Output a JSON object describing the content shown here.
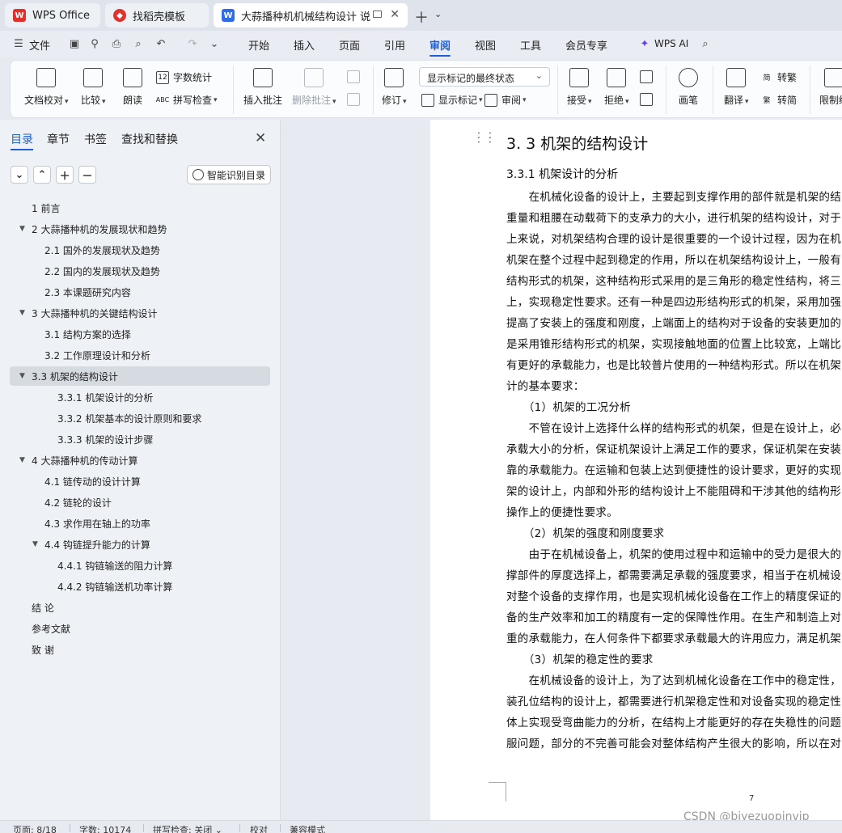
{
  "tabs": [
    {
      "label": "WPS Office",
      "icon": "wps-logo-icon",
      "color": "#e0312d"
    },
    {
      "label": "找稻壳模板",
      "icon": "docer-icon",
      "color": "#e0312d"
    },
    {
      "label": "大蒜播种机机械结构设计 说明",
      "icon": "writer-doc-icon",
      "color": "#2f6be6"
    }
  ],
  "menu": {
    "file": "文件",
    "items": [
      "开始",
      "插入",
      "页面",
      "引用",
      "审阅",
      "视图",
      "工具",
      "会员专享"
    ],
    "active": "审阅",
    "wps_ai": "WPS AI"
  },
  "ribbon": {
    "doc_check": "文档校对",
    "compare": "比较",
    "read_aloud": "朗读",
    "word_count": "字数统计",
    "spell_check": "拼写检查",
    "insert_comment": "插入批注",
    "delete_comment": "删除批注",
    "revise": "修订",
    "markup_state": "显示标记的最终状态",
    "show_markup": "显示标记",
    "review": "审阅",
    "accept": "接受",
    "reject": "拒绝",
    "ink": "画笔",
    "translate": "翻译",
    "to_traditional": "转繁",
    "to_simplified": "转简",
    "restrict": "限制编"
  },
  "nav": {
    "tabs": [
      "目录",
      "章节",
      "书签",
      "查找和替换"
    ],
    "active_tab": "目录",
    "smart_toc": "智能识别目录",
    "toc": [
      {
        "label": "1  前言",
        "level": 1,
        "expand": ""
      },
      {
        "label": "2  大蒜播种机的发展现状和趋势",
        "level": 1,
        "expand": "▼"
      },
      {
        "label": "2.1  国外的发展现状及趋势",
        "level": 2,
        "expand": ""
      },
      {
        "label": "2.2  国内的发展现状及趋势",
        "level": 2,
        "expand": ""
      },
      {
        "label": "2.3  本课题研究内容",
        "level": 2,
        "expand": ""
      },
      {
        "label": "3  大蒜播种机的关键结构设计",
        "level": 1,
        "expand": "▼"
      },
      {
        "label": "3.1 结构方案的选择",
        "level": 2,
        "expand": ""
      },
      {
        "label": "3.2  工作原理设计和分析",
        "level": 2,
        "expand": ""
      },
      {
        "label": "3.3 机架的结构设计",
        "level": 1,
        "expand": "▼",
        "selected": true
      },
      {
        "label": "3.3.1 机架设计的分析",
        "level": 3,
        "expand": ""
      },
      {
        "label": "3.3.2 机架基本的设计原则和要求",
        "level": 3,
        "expand": ""
      },
      {
        "label": "3.3.3 机架的设计步骤",
        "level": 3,
        "expand": ""
      },
      {
        "label": "4  大蒜播种机的传动计算",
        "level": 1,
        "expand": "▼"
      },
      {
        "label": "4.1 链传动的设计计算",
        "level": 2,
        "expand": ""
      },
      {
        "label": "4.2 链轮的设计",
        "level": 2,
        "expand": ""
      },
      {
        "label": "4.3 求作用在轴上的功率",
        "level": 2,
        "expand": ""
      },
      {
        "label": "4.4 钩链提升能力的计算",
        "level": 2,
        "expand": "▼"
      },
      {
        "label": "4.4.1 钩链输送的阻力计算",
        "level": 3,
        "expand": ""
      },
      {
        "label": "4.4.2 钩链输送机功率计算",
        "level": 3,
        "expand": ""
      },
      {
        "label": "结  论",
        "level": 1,
        "expand": ""
      },
      {
        "label": "参考文献",
        "level": 1,
        "expand": ""
      },
      {
        "label": "致  谢",
        "level": 1,
        "expand": ""
      }
    ]
  },
  "document": {
    "heading": "3. 3 机架的结构设计",
    "subheading": "3.3.1 机架设计的分析",
    "lines": [
      "　　在机械化设备的设计上，主要起到支撑作用的部件就是机架的结",
      "重量和粗腰在动载荷下的支承力的大小，进行机架的结构设计，对于",
      "上来说，对机架结构合理的设计是很重要的一个设计过程，因为在机",
      "机架在整个过程中起到稳定的作用，所以在机架结构设计上，一般有",
      "结构形式的机架，这种结构形式采用的是三角形的稳定性结构，将三",
      "上，实现稳定性要求。还有一种是四边形结构形式的机架，采用加强",
      "提高了安装上的强度和刚度，上端面上的结构对于设备的安装更加的",
      "是采用锥形结构形式的机架，实现接触地面的位置上比较宽，上端比",
      "有更好的承载能力，也是比较普片使用的一种结构形式。所以在机架",
      "计的基本要求：",
      "　　（1）机架的工况分析",
      "　　不管在设计上选择什么样的结构形式的机架，但是在设计上，必",
      "承载大小的分析，保证机架设计上满足工作的要求，保证机架在安装",
      "靠的承载能力。在运输和包装上达到便捷性的设计要求，更好的实现",
      "架的设计上，内部和外形的结构设计上不能阻碍和干涉其他的结构形",
      "操作上的便捷性要求。",
      "　　（2）机架的强度和刚度要求",
      "　　由于在机械设备上，机架的使用过程中和运输中的受力是很大的",
      "撑部件的厚度选择上，都需要满足承载的强度要求，相当于在机械设",
      "对整个设备的支撑作用，也是实现机械化设备在工作上的精度保证的",
      "备的生产效率和加工的精度有一定的保障性作用。在生产和制造上对",
      "重的承载能力，在人何条件下都要求承载最大的许用应力，满足机架",
      "　　（3）机架的稳定性的要求",
      "　　在机械设备的设计上，为了达到机械化设备在工作中的稳定性，",
      "装孔位结构的设计上，都需要进行机架稳定性和对设备实现的稳定性",
      "体上实现受弯曲能力的分析，在结构上才能更好的存在失稳性的问题",
      "服问题，部分的不完善可能会对整体结构产生很大的影响，所以在对"
    ],
    "page_number": "7"
  },
  "watermark": "CSDN @biyezuopinvip",
  "status": {
    "page": "页面: 8/18",
    "words": "字数: 10174",
    "spell": "拼写检查: 关闭",
    "proof": "校对",
    "compat": "兼容模式"
  },
  "colors": {
    "accent": "#1f5fd1",
    "wps_red": "#e0312d",
    "writer_blue": "#2f6be6"
  }
}
